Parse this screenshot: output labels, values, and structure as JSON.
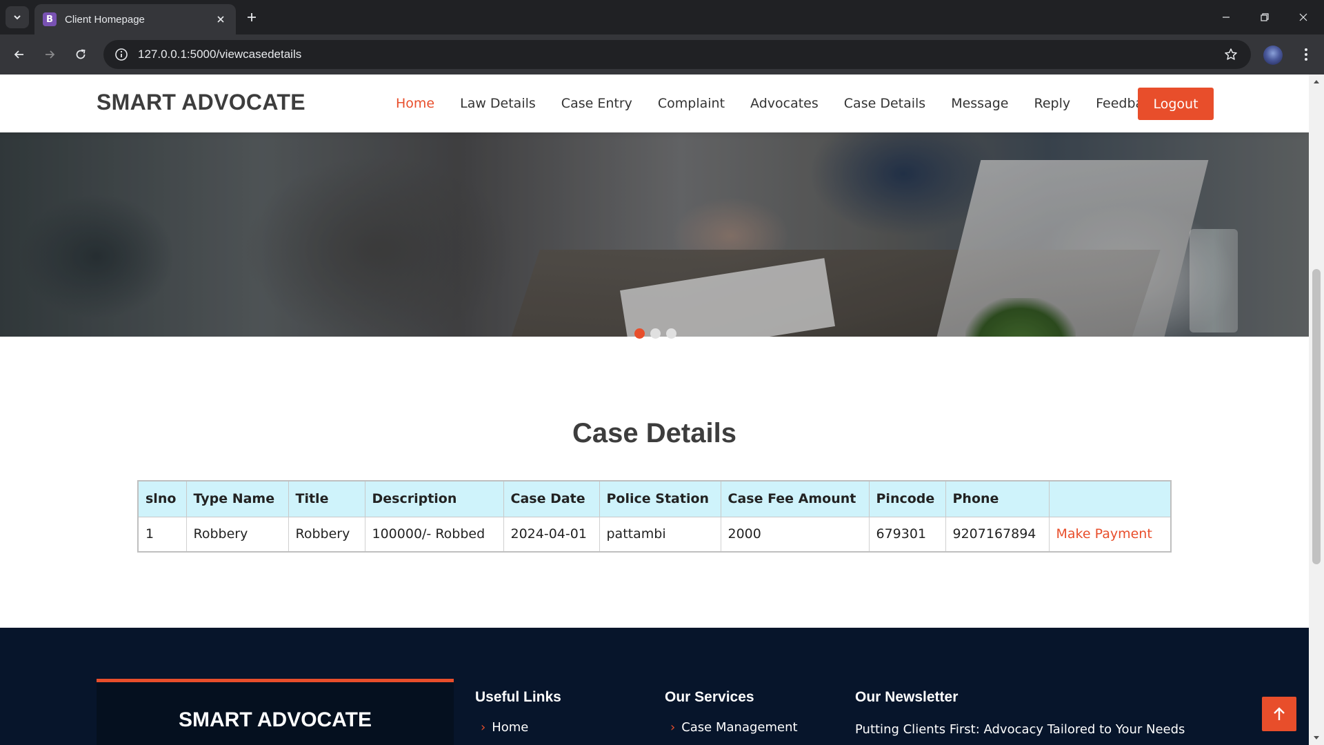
{
  "browser": {
    "tab_title": "Client Homepage",
    "tab_favicon_letter": "B",
    "url": "127.0.0.1:5000/viewcasedetails"
  },
  "site": {
    "brand": "SMART ADVOCATE",
    "nav": [
      "Home",
      "Law Details",
      "Case Entry",
      "Complaint",
      "Advocates",
      "Case Details",
      "Message",
      "Reply",
      "Feedback"
    ],
    "active_nav": "Home",
    "logout_label": "Logout",
    "accent_color": "#e84e2b"
  },
  "carousel": {
    "slide_count": 3,
    "active_index": 0
  },
  "case_details": {
    "title": "Case Details",
    "columns": [
      "slno",
      "Type Name",
      "Title",
      "Description",
      "Case Date",
      "Police Station",
      "Case Fee Amount",
      "Pincode",
      "Phone",
      ""
    ],
    "rows": [
      {
        "slno": "1",
        "type_name": "Robbery",
        "title": "Robbery",
        "description": "100000/- Robbed",
        "case_date": "2024-04-01",
        "police_station": "pattambi",
        "case_fee_amount": "2000",
        "pincode": "679301",
        "phone": "9207167894",
        "action": "Make Payment"
      }
    ]
  },
  "footer": {
    "brand": "SMART ADVOCATE",
    "useful_links_title": "Useful Links",
    "useful_links": [
      "Home"
    ],
    "services_title": "Our Services",
    "services": [
      "Case Management"
    ],
    "newsletter_title": "Our Newsletter",
    "newsletter_text": "Putting Clients First: Advocacy Tailored to Your Needs"
  }
}
